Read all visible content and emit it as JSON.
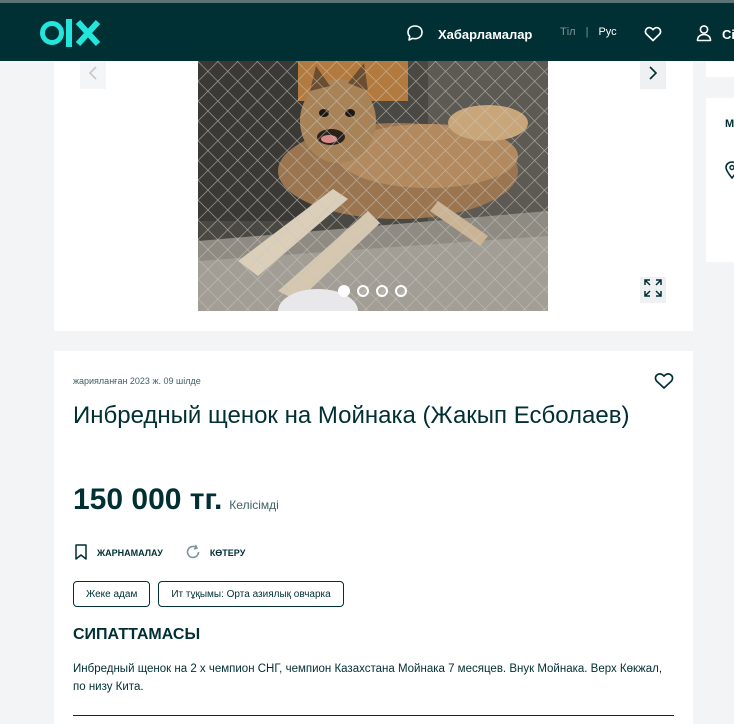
{
  "header": {
    "logo": "OLX",
    "messages_label": "Хабарламалар",
    "lang_label": "Тіл",
    "lang_separator": "|",
    "lang_current": "Рус",
    "profile_label": "Сі"
  },
  "gallery": {
    "image_alt": "dog behind chain-link fence",
    "slide_count": 4,
    "active_slide": 1
  },
  "side": {
    "map_heading": "М"
  },
  "listing": {
    "date": "жарияланған 2023 ж. 09 шілде",
    "title": "Инбредный щенок на Мойнака (Жакып Есболаев)",
    "price": "150 000 тг.",
    "negotiable": "Келісімді",
    "actions": [
      {
        "label": "ЖАРНАМАЛАУ",
        "icon": "bookmark-icon"
      },
      {
        "label": "КӨТЕРУ",
        "icon": "refresh-icon"
      }
    ],
    "tags": [
      "Жеке адам",
      "Ит тұқымы: Орта азиялық овчарка"
    ],
    "section_title": "СИПАТТАМАСЫ",
    "description": "Инбредный щенок на 2 х чемпион СНГ, чемпион Казахстана Мойнака 7 месяцев. Внук Мойнака. Верх Көкжал, по низу Кита."
  },
  "colors": {
    "brand_dark": "#002f34",
    "brand_teal": "#23e5db",
    "background": "#f2f4f5"
  }
}
